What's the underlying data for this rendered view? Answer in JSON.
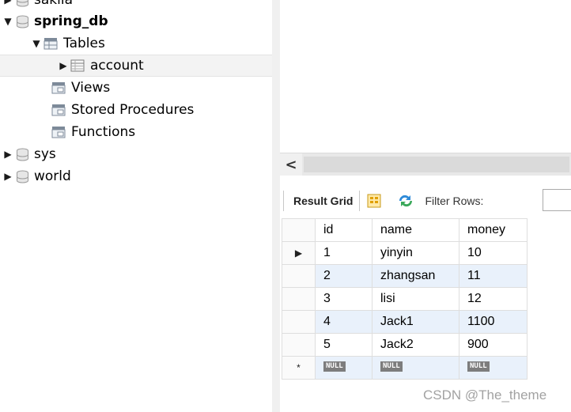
{
  "navigator": {
    "items": [
      {
        "label": "sakila",
        "bold": false,
        "type": "schema",
        "expanded": false
      },
      {
        "label": "spring_db",
        "bold": true,
        "type": "schema",
        "expanded": true
      },
      {
        "label": "Tables",
        "bold": false,
        "type": "folder",
        "expanded": true
      },
      {
        "label": "account",
        "bold": false,
        "type": "table",
        "expanded": false,
        "selected": true
      },
      {
        "label": "Views",
        "bold": false,
        "type": "folder"
      },
      {
        "label": "Stored Procedures",
        "bold": false,
        "type": "folder"
      },
      {
        "label": "Functions",
        "bold": false,
        "type": "folder"
      },
      {
        "label": "sys",
        "bold": false,
        "type": "schema",
        "expanded": false
      },
      {
        "label": "world",
        "bold": false,
        "type": "schema",
        "expanded": false
      }
    ]
  },
  "toolbar": {
    "result_grid_label": "Result Grid",
    "filter_rows_label": "Filter Rows:"
  },
  "grid": {
    "columns": [
      "id",
      "name",
      "money"
    ],
    "rows": [
      [
        "1",
        "yinyin",
        "10"
      ],
      [
        "2",
        "zhangsan",
        "11"
      ],
      [
        "3",
        "lisi",
        "12"
      ],
      [
        "4",
        "Jack1",
        "1100"
      ],
      [
        "5",
        "Jack2",
        "900"
      ]
    ],
    "new_row": [
      "NULL",
      "NULL",
      "NULL"
    ]
  },
  "scrollbar": {
    "left_arrow": "<"
  },
  "markers": {
    "current_row": "▶",
    "new_row": "*"
  },
  "watermark": "CSDN @The_theme",
  "colors": {
    "alt_row": "#e9f1fb",
    "null_badge": "#7d7d7d",
    "selected_row": "#f3f3f3"
  }
}
